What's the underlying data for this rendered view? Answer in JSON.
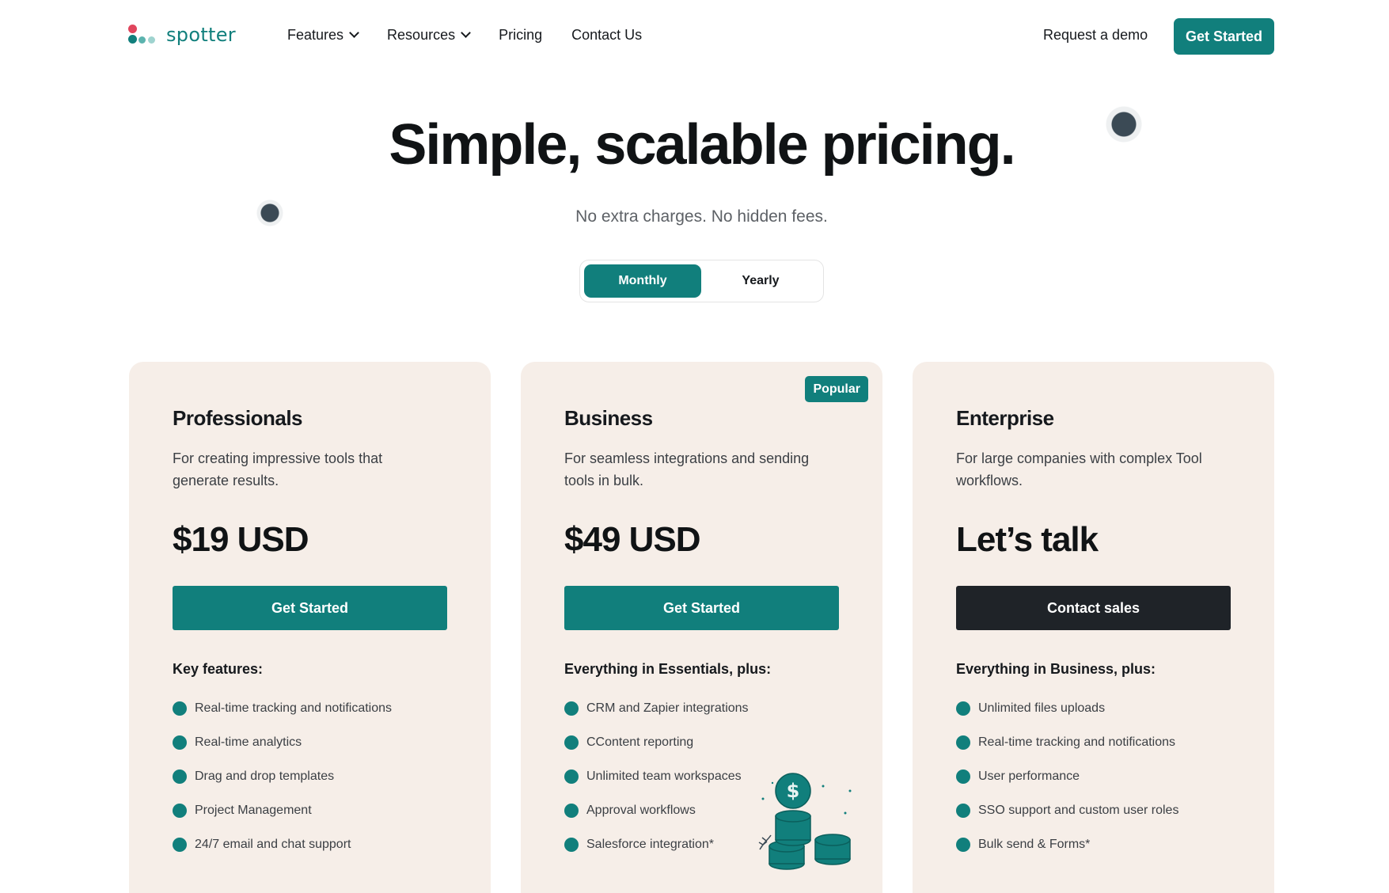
{
  "brand": {
    "name": "spotter"
  },
  "nav": {
    "links": [
      {
        "label": "Features",
        "has_dropdown": true
      },
      {
        "label": "Resources",
        "has_dropdown": true
      },
      {
        "label": "Pricing",
        "has_dropdown": false
      },
      {
        "label": "Contact Us",
        "has_dropdown": false
      }
    ],
    "demo_label": "Request a demo",
    "cta_label": "Get Started"
  },
  "hero": {
    "title": "Simple, scalable pricing.",
    "subtitle": "No extra charges. No hidden fees."
  },
  "billing_toggle": {
    "options": [
      "Monthly",
      "Yearly"
    ],
    "selected": "Monthly"
  },
  "plans": [
    {
      "name": "Professionals",
      "description": "For creating impressive tools that generate results.",
      "price": "$19 USD",
      "button_label": "Get Started",
      "features_heading": "Key features:",
      "features": [
        "Real-time tracking and notifications",
        "Real-time analytics",
        "Drag and drop templates",
        "Project Management",
        "24/7 email and chat support"
      ]
    },
    {
      "name": "Business",
      "badge": "Popular",
      "description": "For seamless integrations and sending tools in bulk.",
      "price": "$49 USD",
      "button_label": "Get Started",
      "features_heading": "Everything in Essentials, plus:",
      "features": [
        "CRM and Zapier integrations",
        "CContent reporting",
        "Unlimited team workspaces",
        "Approval workflows",
        "Salesforce integration*"
      ]
    },
    {
      "name": "Enterprise",
      "description": "For large companies with complex Tool workflows.",
      "price": "Let’s talk",
      "button_label": "Contact sales",
      "features_heading": "Everything in Business, plus:",
      "features": [
        "Unlimited files uploads",
        "Real-time tracking and notifications",
        "User performance",
        "SSO support and custom user roles",
        "Bulk send & Forms*"
      ]
    }
  ],
  "colors": {
    "accent": "#117f7c",
    "card_bg": "#f6eee8",
    "dark_button": "#1f2328",
    "logo_red": "#e0455d"
  },
  "icons": [
    "logo-dots-icon",
    "chevron-down-icon",
    "feature-bullet-icon",
    "coins-stack-icon",
    "decorative-orb-icon"
  ]
}
